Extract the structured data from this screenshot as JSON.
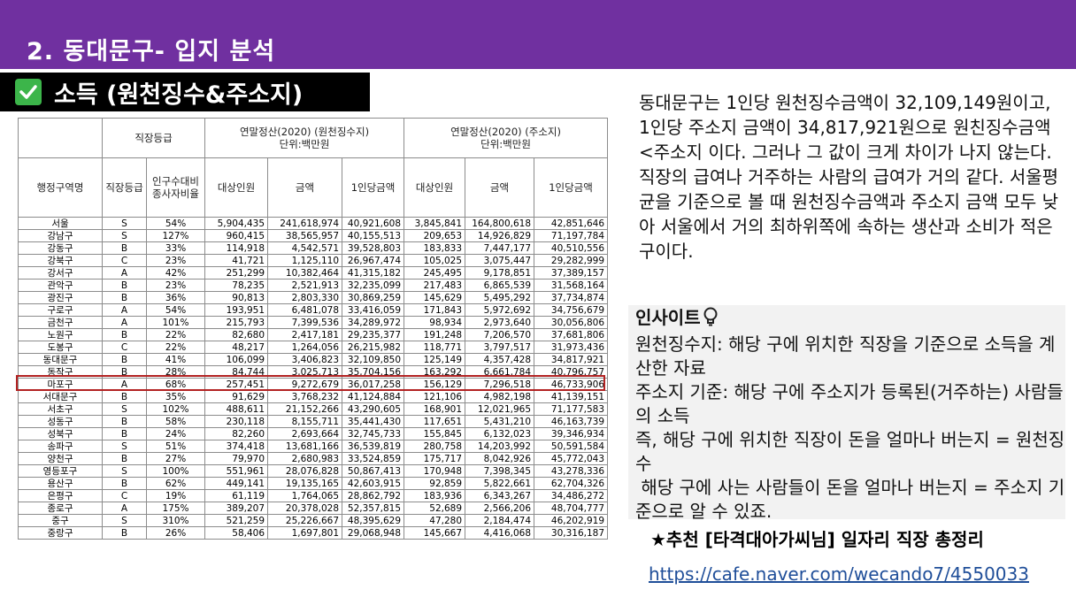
{
  "header": {
    "title": "2. 동대문구- 입지 분석"
  },
  "subheader": {
    "label": "소득 (원천징수&주소지)",
    "icon": "check-icon",
    "icon_color": "#3cb54a"
  },
  "colors": {
    "accent_bar": "#7030a0",
    "highlight": "#b22222",
    "link": "#1f4e99"
  },
  "table": {
    "group_headers": {
      "grade": "직장등급",
      "withholding": "연말정산(2020) (원천징수지)",
      "withholding_unit": "단위:백만원",
      "address": "연말정산(2020) (주소지)",
      "address_unit": "단위:백만원"
    },
    "columns": [
      "행정구역명",
      "직장등급",
      "인구수대비 종사자비율",
      "대상인원",
      "금액",
      "1인당금액",
      "대상인원",
      "금액",
      "1인당금액"
    ],
    "rows": [
      [
        "서울",
        "S",
        "54%",
        "5,904,435",
        "241,618,974",
        "40,921,608",
        "3,845,841",
        "164,800,618",
        "42,851,646"
      ],
      [
        "강남구",
        "S",
        "127%",
        "960,415",
        "38,565,957",
        "40,155,513",
        "209,653",
        "14,926,829",
        "71,197,784"
      ],
      [
        "강동구",
        "B",
        "33%",
        "114,918",
        "4,542,571",
        "39,528,803",
        "183,833",
        "7,447,177",
        "40,510,556"
      ],
      [
        "강북구",
        "C",
        "23%",
        "41,721",
        "1,125,110",
        "26,967,474",
        "105,025",
        "3,075,447",
        "29,282,999"
      ],
      [
        "강서구",
        "A",
        "42%",
        "251,299",
        "10,382,464",
        "41,315,182",
        "245,495",
        "9,178,851",
        "37,389,157"
      ],
      [
        "관악구",
        "B",
        "23%",
        "78,235",
        "2,521,913",
        "32,235,099",
        "217,483",
        "6,865,539",
        "31,568,164"
      ],
      [
        "광진구",
        "B",
        "36%",
        "90,813",
        "2,803,330",
        "30,869,259",
        "145,629",
        "5,495,292",
        "37,734,874"
      ],
      [
        "구로구",
        "A",
        "54%",
        "193,951",
        "6,481,078",
        "33,416,059",
        "171,843",
        "5,972,692",
        "34,756,679"
      ],
      [
        "금천구",
        "A",
        "101%",
        "215,793",
        "7,399,536",
        "34,289,972",
        "98,934",
        "2,973,640",
        "30,056,806"
      ],
      [
        "노원구",
        "B",
        "22%",
        "82,680",
        "2,417,181",
        "29,235,377",
        "191,248",
        "7,206,570",
        "37,681,806"
      ],
      [
        "도봉구",
        "C",
        "22%",
        "48,217",
        "1,264,056",
        "26,215,982",
        "118,771",
        "3,797,517",
        "31,973,436"
      ],
      [
        "동대문구",
        "B",
        "41%",
        "106,099",
        "3,406,823",
        "32,109,850",
        "125,149",
        "4,357,428",
        "34,817,921"
      ],
      [
        "동작구",
        "B",
        "28%",
        "84,744",
        "3,025,713",
        "35,704,156",
        "163,292",
        "6,661,784",
        "40,796,757"
      ],
      [
        "마포구",
        "A",
        "68%",
        "257,451",
        "9,272,679",
        "36,017,258",
        "156,129",
        "7,296,518",
        "46,733,906"
      ],
      [
        "서대문구",
        "B",
        "35%",
        "91,629",
        "3,768,232",
        "41,124,884",
        "121,106",
        "4,982,198",
        "41,139,151"
      ],
      [
        "서초구",
        "S",
        "102%",
        "488,611",
        "21,152,266",
        "43,290,605",
        "168,901",
        "12,021,965",
        "71,177,583"
      ],
      [
        "성동구",
        "B",
        "58%",
        "230,118",
        "8,155,711",
        "35,441,430",
        "117,651",
        "5,431,210",
        "46,163,739"
      ],
      [
        "성북구",
        "B",
        "24%",
        "82,260",
        "2,693,664",
        "32,745,733",
        "155,845",
        "6,132,023",
        "39,346,934"
      ],
      [
        "송파구",
        "S",
        "51%",
        "374,418",
        "13,681,166",
        "36,539,819",
        "280,758",
        "14,203,992",
        "50,591,584"
      ],
      [
        "양천구",
        "B",
        "27%",
        "79,970",
        "2,680,983",
        "33,524,859",
        "175,717",
        "8,042,926",
        "45,772,043"
      ],
      [
        "영등포구",
        "S",
        "100%",
        "551,961",
        "28,076,828",
        "50,867,413",
        "170,948",
        "7,398,345",
        "43,278,336"
      ],
      [
        "용산구",
        "B",
        "62%",
        "449,141",
        "19,135,165",
        "42,603,915",
        "92,859",
        "5,822,661",
        "62,704,326"
      ],
      [
        "은평구",
        "C",
        "19%",
        "61,119",
        "1,764,065",
        "28,862,792",
        "183,936",
        "6,343,267",
        "34,486,272"
      ],
      [
        "종로구",
        "A",
        "175%",
        "389,207",
        "20,378,028",
        "52,357,815",
        "52,689",
        "2,566,206",
        "48,704,777"
      ],
      [
        "중구",
        "S",
        "310%",
        "521,259",
        "25,226,667",
        "48,395,629",
        "47,280",
        "2,184,474",
        "46,202,919"
      ],
      [
        "중랑구",
        "B",
        "26%",
        "58,406",
        "1,697,801",
        "29,068,948",
        "145,667",
        "4,416,068",
        "30,316,187"
      ]
    ]
  },
  "summary": {
    "text": "동대문구는 1인당 원천징수금액이 32,109,149원이고, 1인당 주소지 금액이 34,817,921원으로 원친징수금액<주소지 이다. 그러나 그 값이 크게 차이가 나지 않는다. 직장의 급여나 거주하는 사람의 급여가 거의 같다. 서울평균을 기준으로 볼 때 원천징수금액과 주소지 금액 모두 낮아 서울에서 거의 최하위쪽에 속하는 생산과 소비가 적은 구이다."
  },
  "insight": {
    "title": "인사이트",
    "icon": "lightbulb-icon",
    "line1": "원천징수지: 해당 구에 위치한 직장을 기준으로 소득을 계산한 자료",
    "line2": "주소지 기준: 해당 구에 주소지가 등록된(거주하는) 사람들의 소득",
    "line3": "즉, 해당 구에 위치한 직장이 돈을 얼마나 버는지 = 원천징수",
    "line4": " 해당 구에 사는 사람들이 돈을 얼마나 버는지 = 주소지 기준으로 알 수 있죠."
  },
  "recommend": {
    "text": "★추천 [타격대아가씨님] 일자리 직장 총정리"
  },
  "link": {
    "url": "https://cafe.naver.com/wecando7/4550033"
  }
}
